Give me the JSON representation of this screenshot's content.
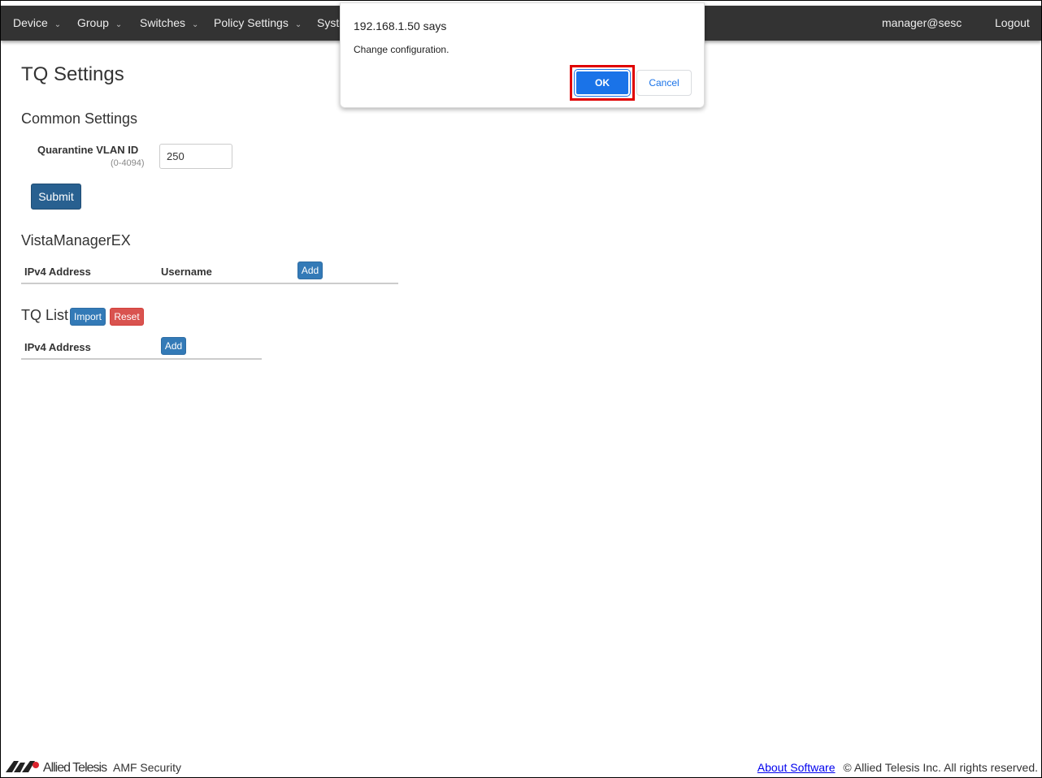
{
  "nav": {
    "items": [
      {
        "label": "Device"
      },
      {
        "label": "Group"
      },
      {
        "label": "Switches"
      },
      {
        "label": "Policy Settings"
      },
      {
        "label": "Syste"
      }
    ],
    "user": "manager@sesc",
    "logout": "Logout"
  },
  "page": {
    "title": "TQ Settings"
  },
  "common": {
    "heading": "Common Settings",
    "vlan_label": "Quarantine VLAN ID",
    "vlan_hint": "(0-4094)",
    "vlan_value": "250",
    "submit": "Submit"
  },
  "vista": {
    "heading": "VistaManagerEX",
    "col_ip": "IPv4 Address",
    "col_user": "Username",
    "add": "Add"
  },
  "tqlist": {
    "heading": "TQ List",
    "import": "Import",
    "reset": "Reset",
    "col_ip": "IPv4 Address",
    "add": "Add"
  },
  "dialog": {
    "title": "192.168.1.50 says",
    "message": "Change configuration.",
    "ok": "OK",
    "cancel": "Cancel"
  },
  "footer": {
    "brand": "Allied Telesis",
    "product": "AMF Security",
    "about": "About Software",
    "copyright": "© Allied Telesis Inc. All rights reserved."
  },
  "colors": {
    "nav": "#333333",
    "primary": "#337ab7",
    "danger": "#d9534f",
    "dialog_ok": "#1a73e8",
    "highlight": "#e00000"
  }
}
